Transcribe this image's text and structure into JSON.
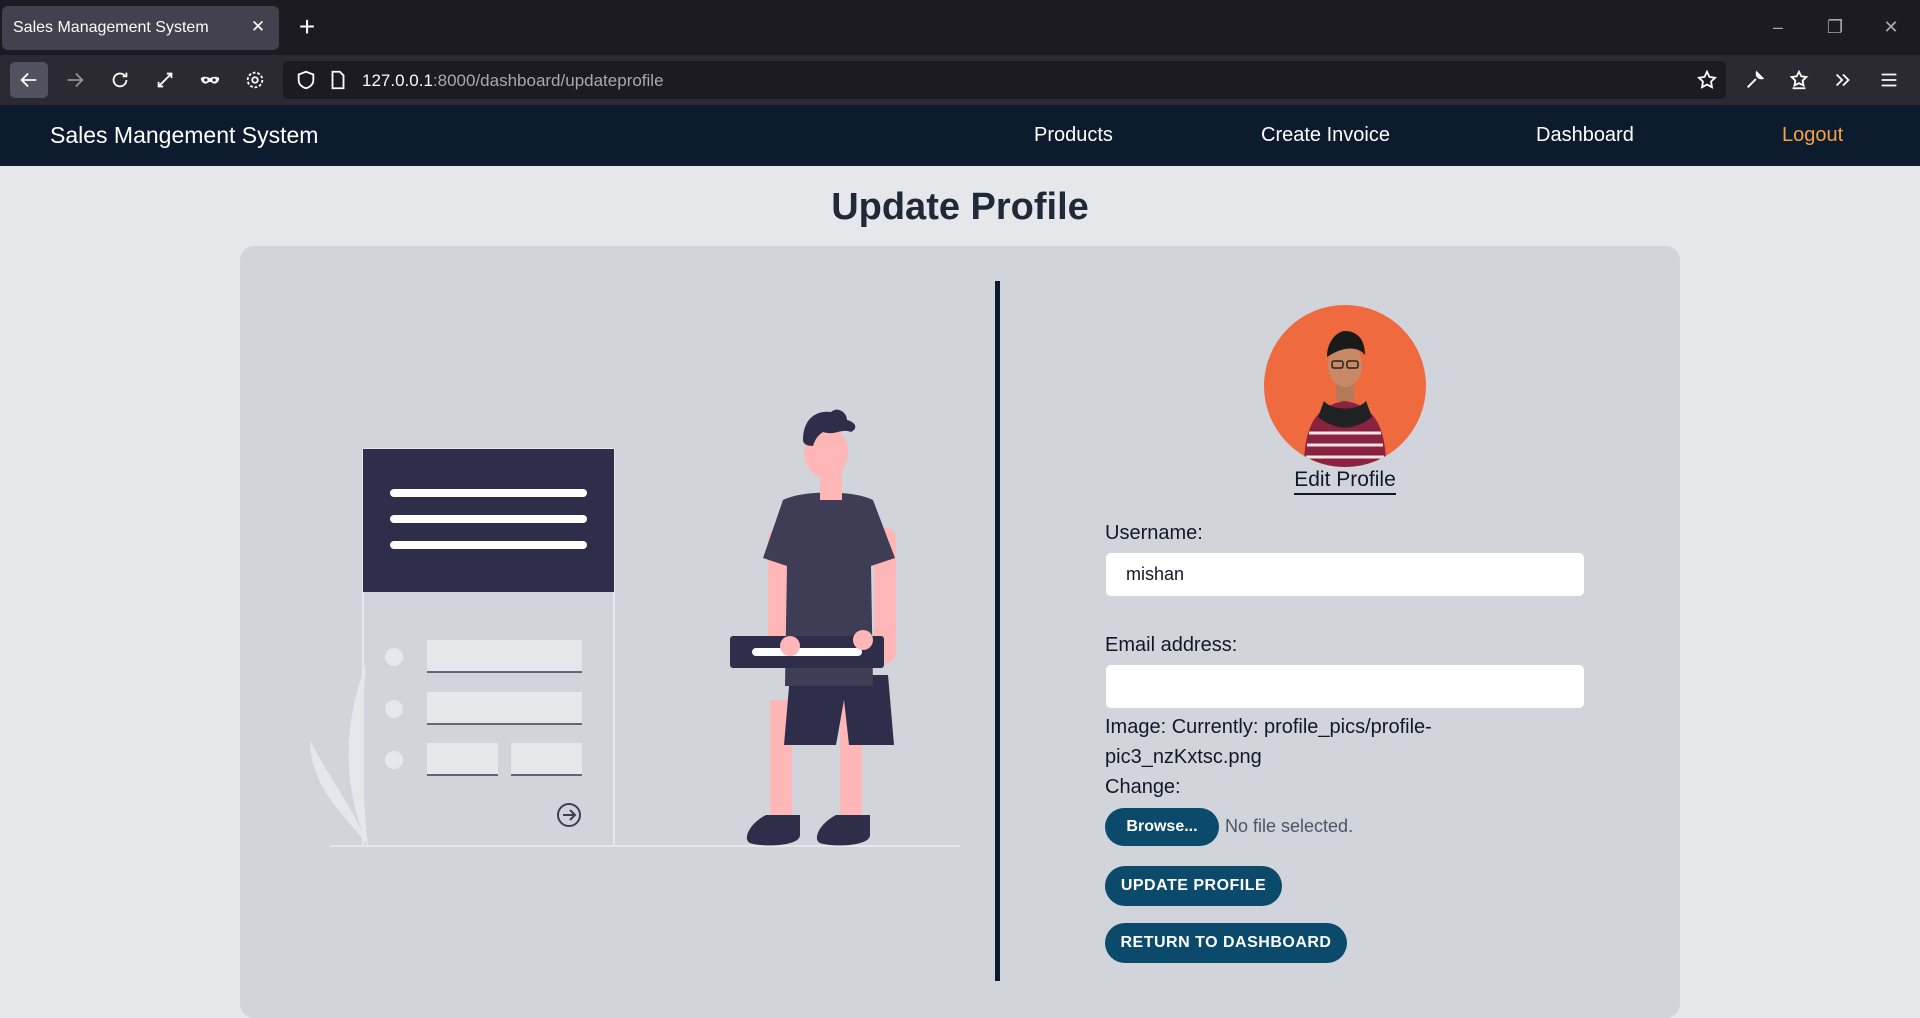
{
  "browser": {
    "tab_title": "Sales Management System",
    "url_host": "127.0.0.1",
    "url_rest": ":8000/dashboard/updateprofile"
  },
  "site": {
    "brand": "Sales Mangement System",
    "nav": {
      "products": "Products",
      "create_invoice": "Create Invoice",
      "dashboard": "Dashboard",
      "logout": "Logout"
    }
  },
  "page": {
    "title": "Update Profile",
    "edit_profile": "Edit Profile",
    "form": {
      "username_label": "Username:",
      "username_value": "mishan",
      "email_label": "Email address:",
      "email_value": "",
      "image_line1": "Image: Currently: profile_pics/profile-",
      "image_line2": "pic3_nzKxtsc.png",
      "change_label": "Change:",
      "browse_label": "Browse...",
      "no_file": "No file selected.",
      "update_button": "UPDATE PROFILE",
      "return_button": "RETURN TO DASHBOARD"
    }
  },
  "colors": {
    "header_bg": "#0c1b2e",
    "accent": "#0b4a6b",
    "logout": "#f4a340",
    "avatar_bg": "#ef6a3e"
  }
}
